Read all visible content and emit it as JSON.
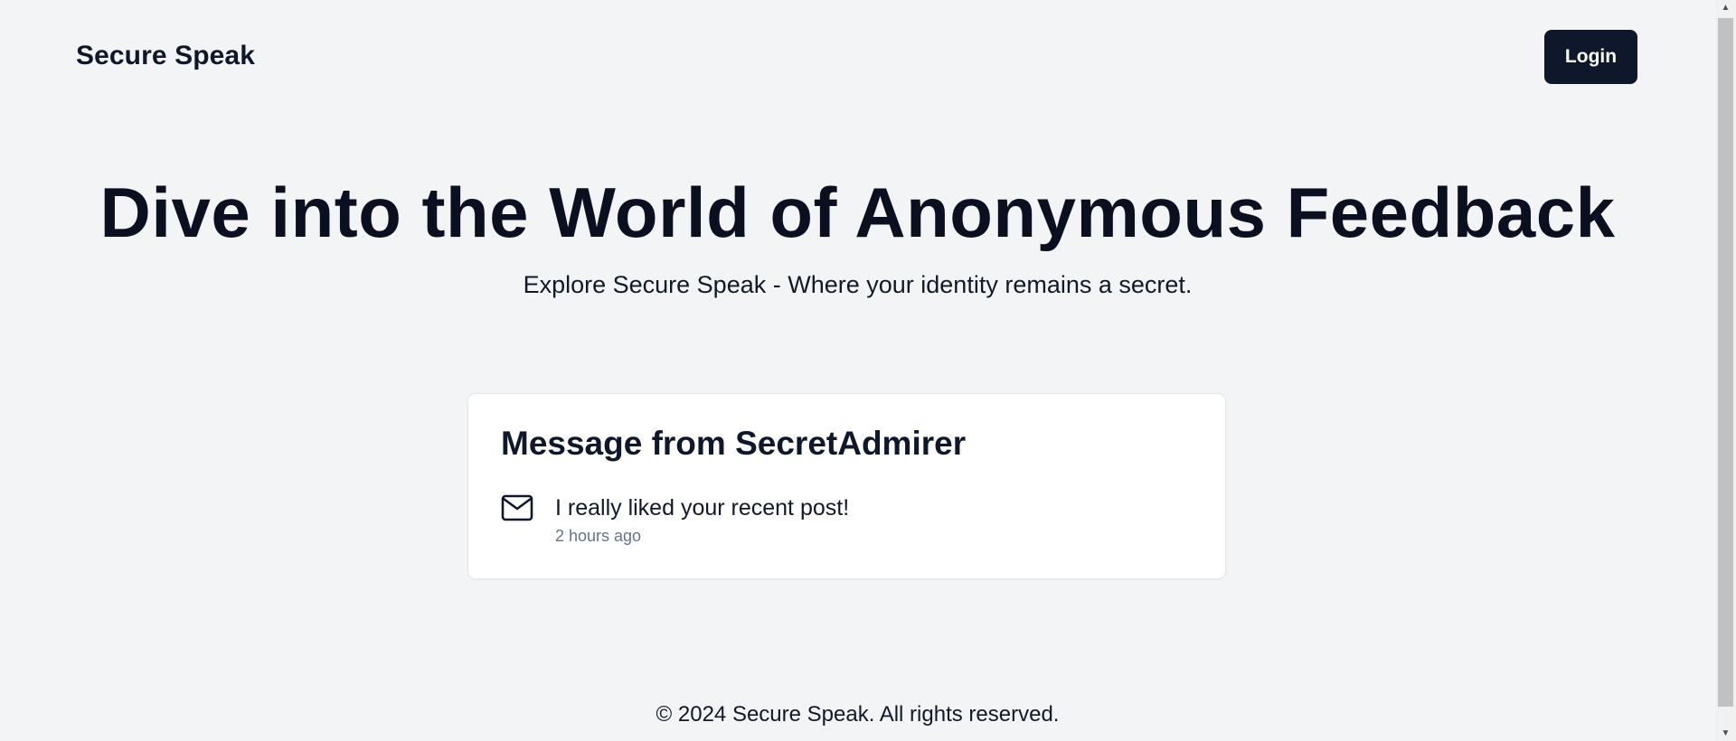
{
  "header": {
    "brand": "Secure Speak",
    "login_label": "Login"
  },
  "hero": {
    "title": "Dive into the World of Anonymous Feedback",
    "subtitle": "Explore Secure Speak - Where your identity remains a secret."
  },
  "message_card": {
    "title": "Message from SecretAdmirer",
    "icon": "mail-icon",
    "text": "I really liked your recent post!",
    "time": "2 hours ago"
  },
  "footer": {
    "copyright": "© 2024 Secure Speak. All rights reserved."
  },
  "colors": {
    "background": "#f3f4f6",
    "primary": "#0f172a",
    "muted": "#64748b",
    "card": "#ffffff"
  }
}
